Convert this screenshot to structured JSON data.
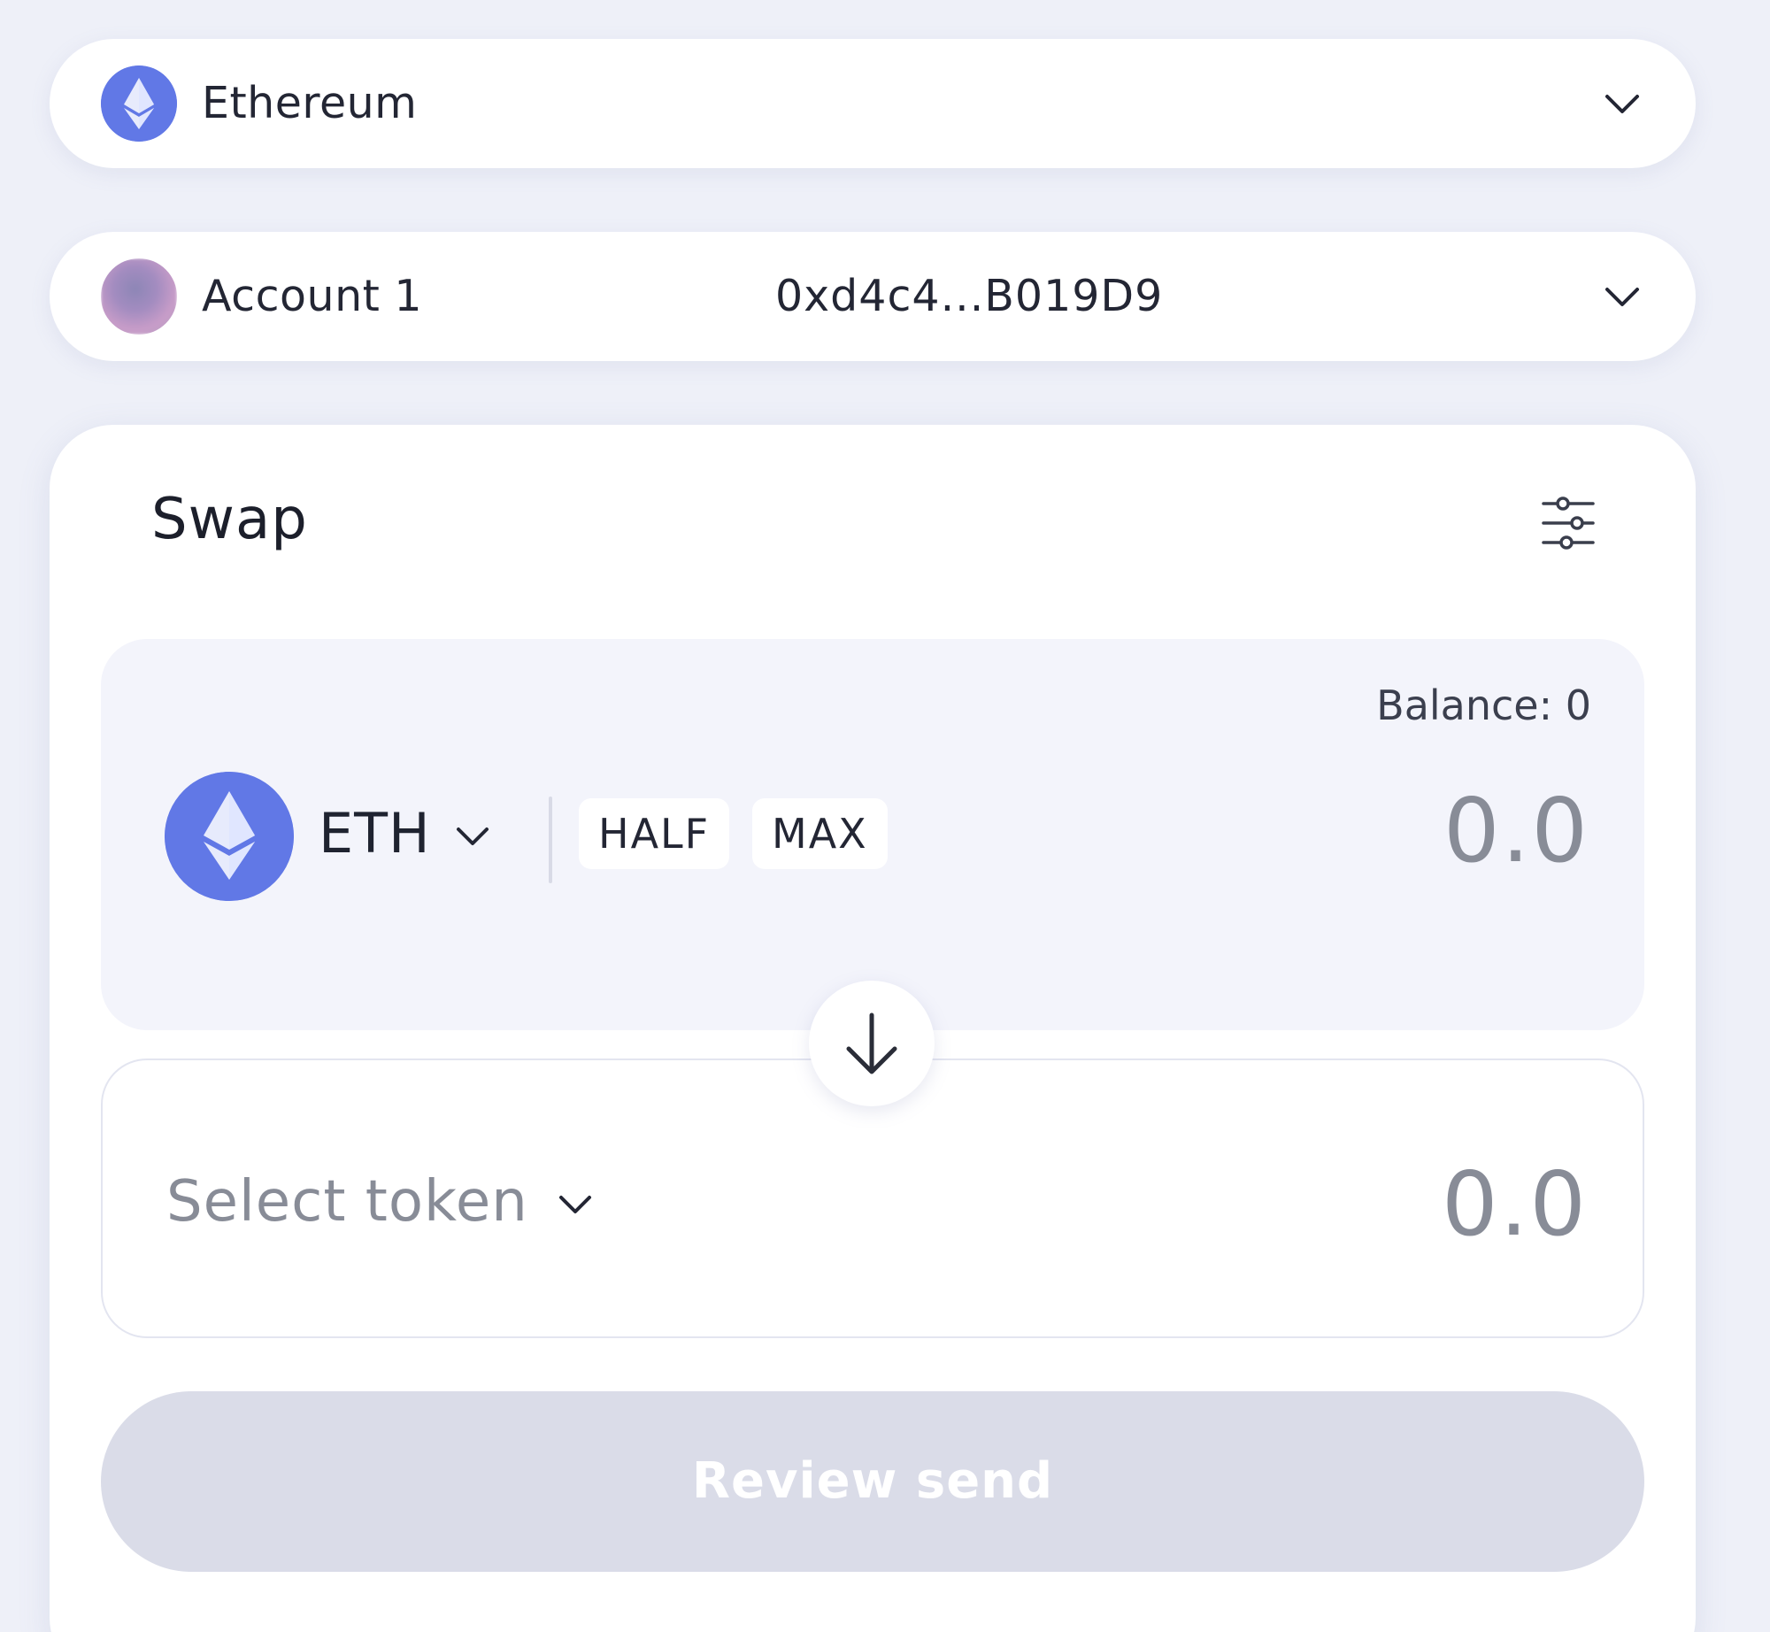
{
  "network": {
    "label": "Ethereum",
    "icon": "ethereum-icon",
    "chevron_icon": "chevron-down-icon"
  },
  "account": {
    "label": "Account 1",
    "address": "0xd4c4...B019D9",
    "icon": "account-avatar",
    "chevron_icon": "chevron-down-icon"
  },
  "swap": {
    "title": "Swap",
    "settings_icon": "sliders-icon",
    "from": {
      "balance_label": "Balance: 0",
      "token_symbol": "ETH",
      "token_icon": "ethereum-icon",
      "half_label": "HALF",
      "max_label": "MAX",
      "amount_placeholder": "0.0"
    },
    "direction_icon": "arrow-down-icon",
    "to": {
      "select_label": "Select token",
      "amount_placeholder": "0.0"
    },
    "review_button_label": "Review send"
  },
  "colors": {
    "accent": "#6178E6",
    "background": "#EEF0F8",
    "disabled_button": "#DADCE8",
    "muted_text": "#888C97"
  }
}
